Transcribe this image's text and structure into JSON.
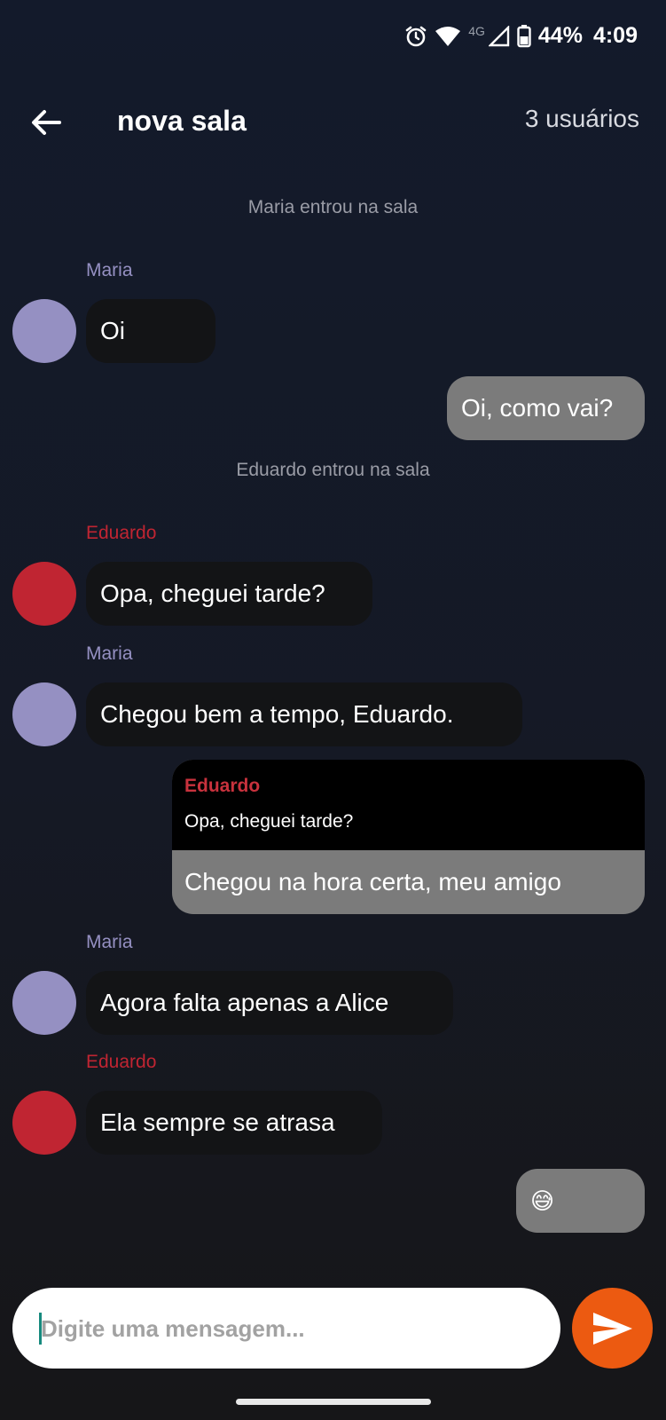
{
  "status_bar": {
    "network": "4G",
    "battery": "44%",
    "time": "4:09"
  },
  "header": {
    "title": "nova sala",
    "users": "3 usuários"
  },
  "messages": [
    {
      "type": "system",
      "text": "Maria entrou na sala"
    },
    {
      "type": "incoming",
      "sender": "Maria",
      "text": "Oi",
      "color": "#9590c2"
    },
    {
      "type": "outgoing",
      "text": "Oi, como vai?"
    },
    {
      "type": "system",
      "text": "Eduardo entrou na sala"
    },
    {
      "type": "incoming",
      "sender": "Eduardo",
      "text": "Opa, cheguei tarde?",
      "color": "#c02532"
    },
    {
      "type": "incoming",
      "sender": "Maria",
      "text": "Chegou bem a tempo, Eduardo.",
      "color": "#9590c2"
    },
    {
      "type": "outgoing_reply",
      "quoted_sender": "Eduardo",
      "quoted_text": "Opa, cheguei tarde?",
      "text": "Chegou na hora certa, meu amigo"
    },
    {
      "type": "incoming",
      "sender": "Maria",
      "text": "Agora falta apenas a Alice",
      "color": "#9590c2"
    },
    {
      "type": "incoming",
      "sender": "Eduardo",
      "text": "Ela sempre se atrasa",
      "color": "#c02532"
    },
    {
      "type": "outgoing",
      "text": "😅"
    }
  ],
  "composer": {
    "placeholder": "Digite uma mensagem..."
  },
  "colors": {
    "send_button": "#ec5a11",
    "outgoing_bubble": "#7b7b7b",
    "incoming_bubble": "#131416"
  },
  "icons": {
    "back": "arrow-left-icon",
    "send": "send-icon",
    "alarm": "alarm-icon",
    "wifi": "wifi-icon",
    "signal": "signal-icon",
    "battery": "battery-icon"
  }
}
